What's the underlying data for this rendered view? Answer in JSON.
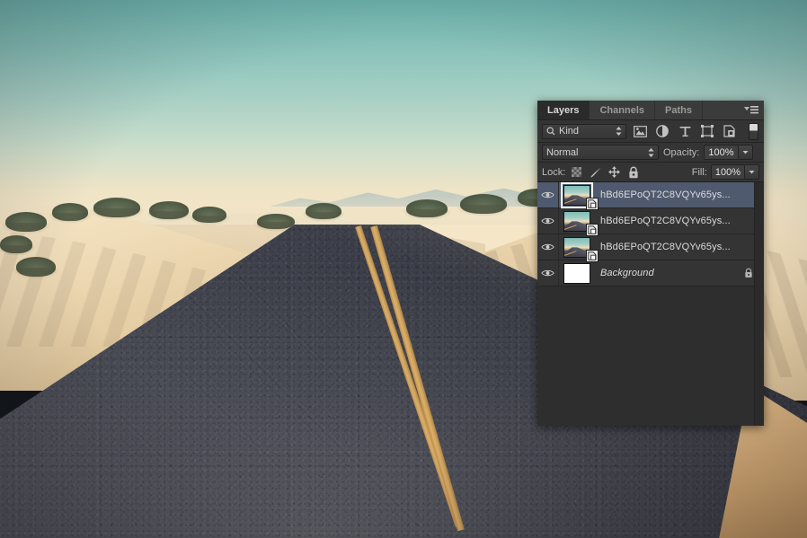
{
  "photo": {
    "description": "desert-road-photograph",
    "sky_color": "#8cc3bb",
    "sand_color": "#eadbb6",
    "road_color": "#4a4c57",
    "line_color": "#caa05c"
  },
  "panel": {
    "title": "Layers",
    "tabs": [
      {
        "label": "Layers",
        "active": true
      },
      {
        "label": "Channels",
        "active": false
      },
      {
        "label": "Paths",
        "active": false
      }
    ],
    "menu_icon": "panel-menu-icon",
    "filter": {
      "kind_label": "Kind",
      "search_icon": "search-icon",
      "stepper_icon": "updown-stepper-icon",
      "type_filters": [
        {
          "name": "filter-pixel-layers",
          "icon": "image-icon"
        },
        {
          "name": "filter-adjustment-layers",
          "icon": "adjustment-icon"
        },
        {
          "name": "filter-type-layers",
          "icon": "text-t-icon"
        },
        {
          "name": "filter-shape-layers",
          "icon": "shape-icon"
        },
        {
          "name": "filter-smart-objects",
          "icon": "smart-object-icon"
        }
      ],
      "toggle_name": "filter-enable-toggle"
    },
    "blend": {
      "mode": "Normal",
      "opacity_label": "Opacity:",
      "opacity_value": "100%",
      "fill_label": "Fill:",
      "fill_value": "100%"
    },
    "lock": {
      "label": "Lock:",
      "items": [
        {
          "name": "lock-transparent-pixels",
          "icon": "checkerboard-icon"
        },
        {
          "name": "lock-image-pixels",
          "icon": "brush-icon"
        },
        {
          "name": "lock-position",
          "icon": "move-arrows-icon"
        },
        {
          "name": "lock-all",
          "icon": "padlock-icon"
        }
      ]
    },
    "layers": [
      {
        "name": "hBd6EPoQT2C8VQYv65ys...",
        "visible": true,
        "selected": true,
        "thumb": "photo",
        "smart_object": true,
        "locked": false,
        "italic": false
      },
      {
        "name": "hBd6EPoQT2C8VQYv65ys...",
        "visible": true,
        "selected": false,
        "thumb": "photo",
        "smart_object": true,
        "locked": false,
        "italic": false
      },
      {
        "name": "hBd6EPoQT2C8VQYv65ys...",
        "visible": true,
        "selected": false,
        "thumb": "photo",
        "smart_object": true,
        "locked": false,
        "italic": false
      },
      {
        "name": "Background",
        "visible": true,
        "selected": false,
        "thumb": "white",
        "smart_object": false,
        "locked": true,
        "italic": true
      }
    ],
    "colors": {
      "panel_bg": "#2b2b2b",
      "row_bg": "#343434",
      "selected_row": "#4f5a6e",
      "text": "#dcdcdc"
    }
  }
}
